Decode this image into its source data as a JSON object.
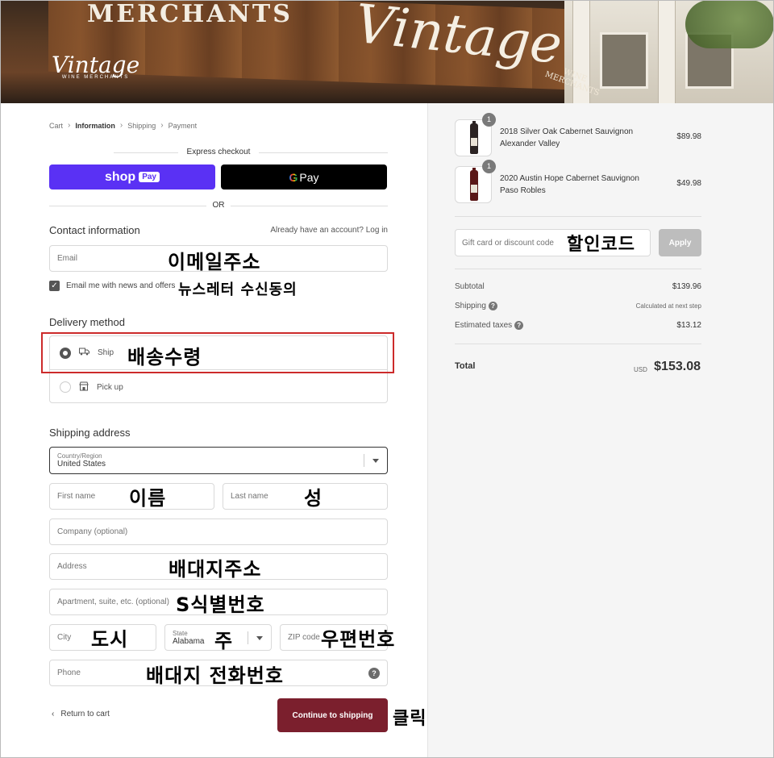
{
  "banner": {
    "top_sign": "MERCHANTS",
    "big_sign": "Vintage",
    "side_sign_1": "WINE",
    "side_sign_2": "MERCHANTS",
    "logo_script": "Vintage",
    "logo_sub": "WINE MERCHANTS"
  },
  "breadcrumb": [
    "Cart",
    "Information",
    "Shipping",
    "Payment"
  ],
  "express": {
    "label": "Express checkout",
    "shop_label": "shop",
    "shop_badge": "Pay",
    "gpay_g": "G",
    "gpay_label": "Pay",
    "or": "OR"
  },
  "contact": {
    "title": "Contact information",
    "login_prompt": "Already have an account? Log in",
    "email_placeholder": "Email",
    "newsletter_label": "Email me with news and offers"
  },
  "delivery": {
    "title": "Delivery method",
    "options": [
      {
        "label": "Ship",
        "selected": true
      },
      {
        "label": "Pick up",
        "selected": false
      }
    ]
  },
  "shipping": {
    "title": "Shipping address",
    "country_label": "Country/Region",
    "country_value": "United States",
    "first_name": "First name",
    "last_name": "Last name",
    "company": "Company (optional)",
    "address": "Address",
    "apartment": "Apartment, suite, etc. (optional)",
    "city": "City",
    "state_label": "State",
    "state_value": "Alabama",
    "zip": "ZIP code",
    "phone": "Phone"
  },
  "footer": {
    "return": "Return to cart",
    "continue": "Continue to shipping"
  },
  "annotations": {
    "email": "이메일주소",
    "newsletter": "뉴스레터 수신동의",
    "ship": "배송수령",
    "first": "이름",
    "last": "성",
    "address": "배대지주소",
    "apartment": "S식별번호",
    "city": "도시",
    "state": "주",
    "zip": "우편번호",
    "phone": "배대지 전화번호",
    "click": "클릭",
    "discount": "할인코드"
  },
  "cart": {
    "items": [
      {
        "qty": "1",
        "name": "2018 Silver Oak Cabernet Sauvignon Alexander Valley",
        "price": "$89.98"
      },
      {
        "qty": "1",
        "name": "2020 Austin Hope Cabernet Sauvignon Paso Robles",
        "price": "$49.98"
      }
    ],
    "discount_placeholder": "Gift card or discount code",
    "apply": "Apply",
    "subtotal_label": "Subtotal",
    "subtotal": "$139.96",
    "shipping_label": "Shipping",
    "shipping_value": "Calculated at next step",
    "taxes_label": "Estimated taxes",
    "taxes": "$13.12",
    "total_label": "Total",
    "currency": "USD",
    "total": "$153.08"
  }
}
